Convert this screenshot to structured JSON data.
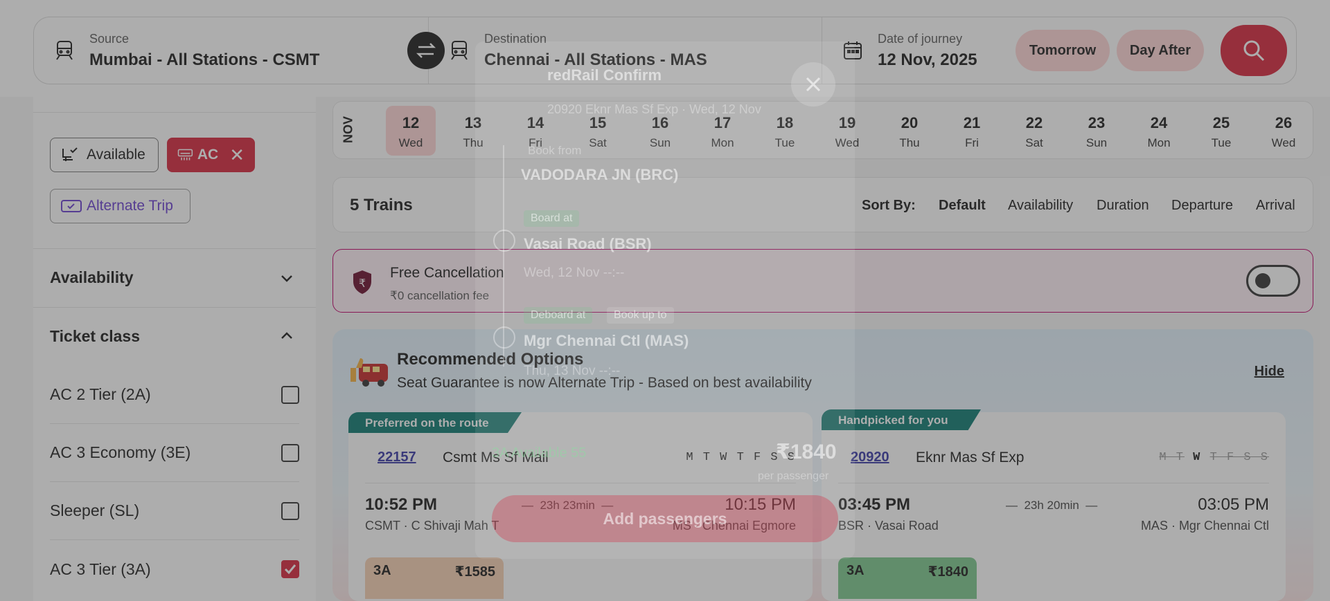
{
  "search": {
    "source_label": "Source",
    "source_value": "Mumbai - All Stations - CSMT",
    "destination_label": "Destination",
    "destination_value": "Chennai - All Stations - MAS",
    "date_label": "Date of journey",
    "date_value": "12 Nov, 2025",
    "quick_dates": [
      "Tomorrow",
      "Day After"
    ]
  },
  "filters": {
    "chips": [
      "Available",
      "AC",
      "Alternate Trip"
    ],
    "availability_title": "Availability",
    "ticket_class_title": "Ticket class",
    "ticket_classes": [
      {
        "label": "AC 2 Tier (2A)",
        "checked": false
      },
      {
        "label": "AC 3 Economy (3E)",
        "checked": false
      },
      {
        "label": "Sleeper (SL)",
        "checked": false
      },
      {
        "label": "AC 3 Tier (3A)",
        "checked": true
      }
    ]
  },
  "date_strip": {
    "month": "NOV",
    "days": [
      {
        "num": "12",
        "day": "Wed",
        "selected": true
      },
      {
        "num": "13",
        "day": "Thu"
      },
      {
        "num": "14",
        "day": "Fri"
      },
      {
        "num": "15",
        "day": "Sat"
      },
      {
        "num": "16",
        "day": "Sun"
      },
      {
        "num": "17",
        "day": "Mon"
      },
      {
        "num": "18",
        "day": "Tue"
      },
      {
        "num": "19",
        "day": "Wed"
      },
      {
        "num": "20",
        "day": "Thu"
      },
      {
        "num": "21",
        "day": "Fri"
      },
      {
        "num": "22",
        "day": "Sat"
      },
      {
        "num": "23",
        "day": "Sun"
      },
      {
        "num": "24",
        "day": "Mon"
      },
      {
        "num": "25",
        "day": "Tue"
      },
      {
        "num": "26",
        "day": "Wed"
      }
    ]
  },
  "results": {
    "count": "5 Trains",
    "sort_label": "Sort By:",
    "sort_options": [
      "Default",
      "Availability",
      "Duration",
      "Departure",
      "Arrival"
    ]
  },
  "free_cancellation": {
    "title": "Free Cancellation",
    "subtitle": "₹0 cancellation fee"
  },
  "recommended": {
    "title": "Recommended Options",
    "subtitle": "Seat Guarantee is now Alternate Trip - Based on best availability",
    "hide_label": "Hide",
    "cards": [
      {
        "ribbon": "Preferred on the route",
        "number": "22157",
        "name": "Csmt Ms Sf Mail",
        "runs": "M T W T F S S",
        "dep_time": "10:52 PM",
        "duration": "23h 23min",
        "arr_time": "10:15 PM",
        "from": "CSMT · C Shivaji Mah T",
        "to": "MS · Chennai Egmore",
        "class": "3A",
        "price": "₹1585"
      },
      {
        "ribbon": "Handpicked for you",
        "number": "20920",
        "name": "Eknr Mas Sf Exp",
        "runs_off1": "M T",
        "runs_on": "W",
        "runs_off2": "T F S S",
        "dep_time": "03:45 PM",
        "duration": "23h 20min",
        "arr_time": "03:05 PM",
        "from": "BSR · Vasai Road",
        "to": "MAS · Mgr Chennai Ctl",
        "class": "3A",
        "price": "₹1840"
      }
    ]
  },
  "modal": {
    "title": "redRail Confirm",
    "train_info": "20920 Eknr Mas Sf Exp · Wed, 12 Nov",
    "book_from_label": "Book from",
    "book_from": "VADODARA JN (BRC)",
    "board_at_label": "Board at",
    "board_at": "Vasai Road (BSR)",
    "board_time": "Wed, 12 Nov --:--",
    "deboard_label": "Deboard at",
    "book_upto_label": "Book up to",
    "deboard_at": "Mgr Chennai Ctl (MAS)",
    "deboard_time": "Thu, 13 Nov --:--",
    "availability": "3A Available 55",
    "price": "₹1840",
    "per_passenger": "per passenger",
    "add_button": "Add passengers"
  },
  "colors": {
    "brand_red": "#d7263d",
    "teal_ribbon": "#0e7a72",
    "link_blue": "#3a3aa8"
  }
}
